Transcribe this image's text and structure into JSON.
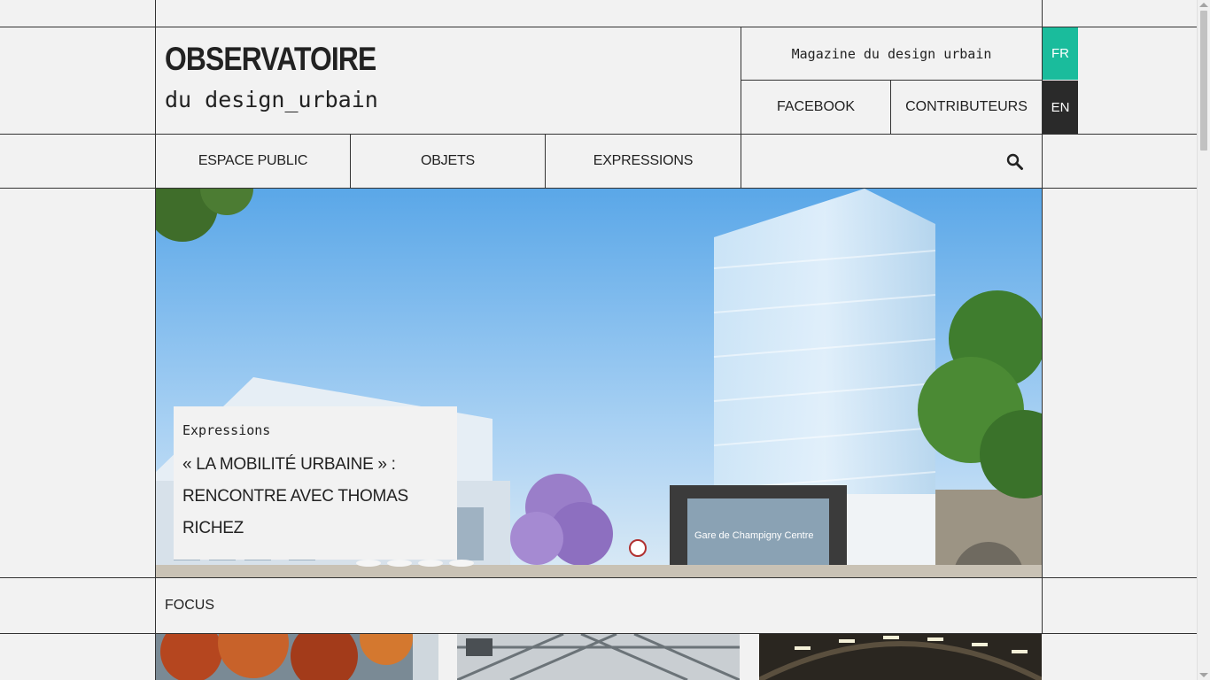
{
  "header": {
    "logo_title": "OBSERVATOIRE",
    "logo_subtitle": "du design_urbain",
    "tagline": "Magazine du design urbain",
    "links": {
      "facebook": "FACEBOOK",
      "contributors": "CONTRIBUTEURS"
    },
    "languages": [
      {
        "code": "FR",
        "active": true
      },
      {
        "code": "EN",
        "active": false
      }
    ]
  },
  "nav": {
    "items": [
      "ESPACE PUBLIC",
      "OBJETS",
      "EXPRESSIONS"
    ],
    "search_icon": "search-icon"
  },
  "hero": {
    "category": "Expressions",
    "title_line1": "« LA MOBILITÉ URBAINE » :",
    "title_line2": "RENCONTRE AVEC THOMAS RICHEZ",
    "image_sign": "Gare de Champigny Centre"
  },
  "focus": {
    "label": "FOCUS"
  },
  "colors": {
    "background": "#f2f2f2",
    "accent_fr": "#1abc9c",
    "dark_en": "#2a2a2a",
    "lines": "#333333"
  }
}
